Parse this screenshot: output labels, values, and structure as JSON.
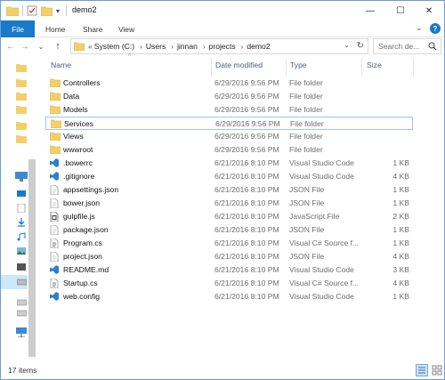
{
  "window": {
    "title": "demo2",
    "controls": {
      "minimize": "—",
      "maximize": "☐",
      "close": "✕"
    }
  },
  "ribbon": {
    "file_tab": "File",
    "tabs": [
      "Home",
      "Share",
      "View"
    ],
    "expand_glyph": "⌄",
    "help_glyph": "?"
  },
  "address": {
    "overflow": "«",
    "crumbs": [
      "System (C:)",
      "Users",
      "jinnan",
      "projects",
      "demo2"
    ],
    "separator": "›",
    "dropdown_glyph": "⌄"
  },
  "search": {
    "placeholder": "Search de..."
  },
  "columns": {
    "name": "Name",
    "date": "Date modified",
    "type": "Type",
    "size": "Size"
  },
  "files": [
    {
      "name": "Controllers",
      "date": "6/29/2016 9:56 PM",
      "type": "File folder",
      "size": "",
      "icon": "folder-icon"
    },
    {
      "name": "Data",
      "date": "6/29/2016 9:56 PM",
      "type": "File folder",
      "size": "",
      "icon": "folder-icon"
    },
    {
      "name": "Models",
      "date": "6/29/2016 9:56 PM",
      "type": "File folder",
      "size": "",
      "icon": "folder-icon"
    },
    {
      "name": "Services",
      "date": "6/29/2016 9:56 PM",
      "type": "File folder",
      "size": "",
      "icon": "folder-icon",
      "selected": true
    },
    {
      "name": "Views",
      "date": "6/29/2016 9:56 PM",
      "type": "File folder",
      "size": "",
      "icon": "folder-icon"
    },
    {
      "name": "wwwroot",
      "date": "6/29/2016 9:56 PM",
      "type": "File folder",
      "size": "",
      "icon": "folder-icon"
    },
    {
      "name": ".bowerrc",
      "date": "6/21/2016 8:10 PM",
      "type": "Visual Studio Code",
      "size": "1 KB",
      "icon": "vscode-file-icon"
    },
    {
      "name": ".gitignore",
      "date": "6/21/2016 8:10 PM",
      "type": "Visual Studio Code",
      "size": "4 KB",
      "icon": "vscode-file-icon"
    },
    {
      "name": "appsettings.json",
      "date": "6/21/2016 8:10 PM",
      "type": "JSON File",
      "size": "1 KB",
      "icon": "json-file-icon"
    },
    {
      "name": "bower.json",
      "date": "6/21/2016 8:10 PM",
      "type": "JSON File",
      "size": "1 KB",
      "icon": "json-file-icon"
    },
    {
      "name": "gulpfile.js",
      "date": "6/21/2016 8:10 PM",
      "type": "JavaScript File",
      "size": "2 KB",
      "icon": "js-file-icon"
    },
    {
      "name": "package.json",
      "date": "6/21/2016 8:10 PM",
      "type": "JSON File",
      "size": "1 KB",
      "icon": "json-file-icon"
    },
    {
      "name": "Program.cs",
      "date": "6/21/2016 8:10 PM",
      "type": "Visual C# Source f...",
      "size": "1 KB",
      "icon": "csharp-file-icon"
    },
    {
      "name": "project.json",
      "date": "6/21/2016 8:10 PM",
      "type": "JSON File",
      "size": "4 KB",
      "icon": "json-file-icon"
    },
    {
      "name": "README.md",
      "date": "6/21/2016 8:10 PM",
      "type": "Visual Studio Code",
      "size": "3 KB",
      "icon": "vscode-file-icon"
    },
    {
      "name": "Startup.cs",
      "date": "6/21/2016 8:10 PM",
      "type": "Visual C# Source f...",
      "size": "4 KB",
      "icon": "csharp-file-icon"
    },
    {
      "name": "web.config",
      "date": "6/21/2016 8:10 PM",
      "type": "Visual Studio Code",
      "size": "1 KB",
      "icon": "vscode-file-icon"
    }
  ],
  "status": {
    "item_count": "17 items"
  },
  "colors": {
    "accent": "#1979ca",
    "folder": "#f3cf6a",
    "selection_border": "#99c9ef",
    "header_text": "#4c607a",
    "vscode_blue": "#2d7fd0"
  }
}
